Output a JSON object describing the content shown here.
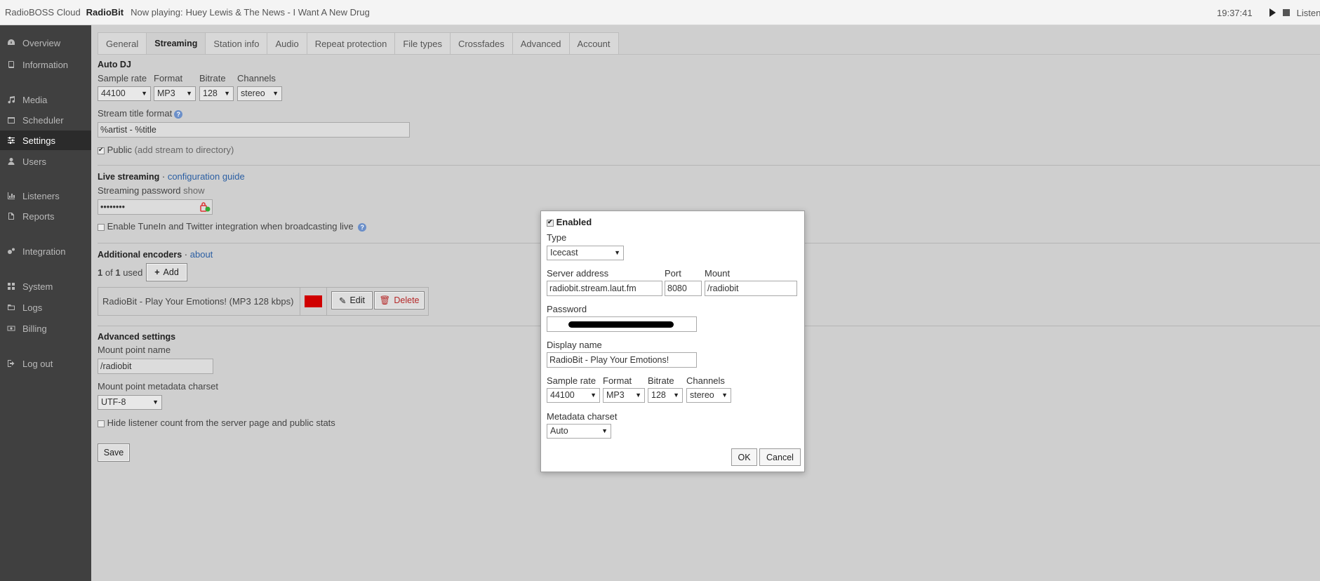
{
  "topbar": {
    "brand": "RadioBOSS Cloud",
    "station": "RadioBit",
    "now_playing_label": "Now playing:",
    "now_playing_track": "Huey Lewis & The News - I Want A New Drug",
    "time": "19:37:41",
    "listeners_label": "Listeners"
  },
  "sidebar": {
    "items": [
      {
        "label": "Overview",
        "icon": "dashboard-icon"
      },
      {
        "label": "Information",
        "icon": "book-icon"
      },
      {
        "label": "Media",
        "icon": "music-icon"
      },
      {
        "label": "Scheduler",
        "icon": "calendar-icon"
      },
      {
        "label": "Settings",
        "icon": "sliders-icon"
      },
      {
        "label": "Users",
        "icon": "user-icon"
      },
      {
        "label": "Listeners",
        "icon": "bar-chart-icon"
      },
      {
        "label": "Reports",
        "icon": "file-icon"
      },
      {
        "label": "Integration",
        "icon": "cogs-icon"
      },
      {
        "label": "System",
        "icon": "grid-icon"
      },
      {
        "label": "Logs",
        "icon": "folder-icon"
      },
      {
        "label": "Billing",
        "icon": "money-icon"
      },
      {
        "label": "Log out",
        "icon": "sign-out-icon"
      }
    ],
    "active": "Settings"
  },
  "tabs": [
    "General",
    "Streaming",
    "Station info",
    "Audio",
    "Repeat protection",
    "File types",
    "Crossfades",
    "Advanced",
    "Account"
  ],
  "active_tab": "Streaming",
  "autodj": {
    "title": "Auto DJ",
    "sample_rate_label": "Sample rate",
    "sample_rate": "44100",
    "format_label": "Format",
    "format": "MP3",
    "bitrate_label": "Bitrate",
    "bitrate": "128",
    "channels_label": "Channels",
    "channels": "stereo",
    "stream_title_label": "Stream title format",
    "stream_title_value": "%artist - %title",
    "public_label": "Public",
    "public_note": "(add stream to directory)",
    "public_checked": true
  },
  "live": {
    "title": "Live streaming",
    "sep": "·",
    "guide_link": "configuration guide",
    "password_label": "Streaming password",
    "show_link": "show",
    "password_value": "••••••••",
    "tunein_label": "Enable TuneIn and Twitter integration when broadcasting live"
  },
  "encoders": {
    "title": "Additional encoders",
    "sep": "·",
    "about_link": "about",
    "used_count": "1",
    "used_of": "of",
    "used_total": "1",
    "used_label": "used",
    "add_label": "Add",
    "rows": [
      {
        "name": "RadioBit - Play Your Emotions! (MP3 128 kbps)",
        "color": "#d00000",
        "edit_label": "Edit",
        "delete_label": "Delete"
      }
    ]
  },
  "advanced": {
    "title": "Advanced settings",
    "mount_label": "Mount point name",
    "mount_value": "/radiobit",
    "charset_label": "Mount point metadata charset",
    "charset_value": "UTF-8",
    "hide_label": "Hide listener count from the server page and public stats",
    "save_label": "Save"
  },
  "modal": {
    "enabled_label": "Enabled",
    "enabled_checked": true,
    "type_label": "Type",
    "type_value": "Icecast",
    "server_label": "Server address",
    "server_value": "radiobit.stream.laut.fm",
    "port_label": "Port",
    "port_value": "8080",
    "mount_label": "Mount",
    "mount_value": "/radiobit",
    "password_label": "Password",
    "display_name_label": "Display name",
    "display_name_value": "RadioBit - Play Your Emotions!",
    "sample_rate_label": "Sample rate",
    "sample_rate": "44100",
    "format_label": "Format",
    "format": "MP3",
    "bitrate_label": "Bitrate",
    "bitrate": "128",
    "channels_label": "Channels",
    "channels": "stereo",
    "metadata_label": "Metadata charset",
    "metadata_value": "Auto",
    "ok_label": "OK",
    "cancel_label": "Cancel"
  }
}
